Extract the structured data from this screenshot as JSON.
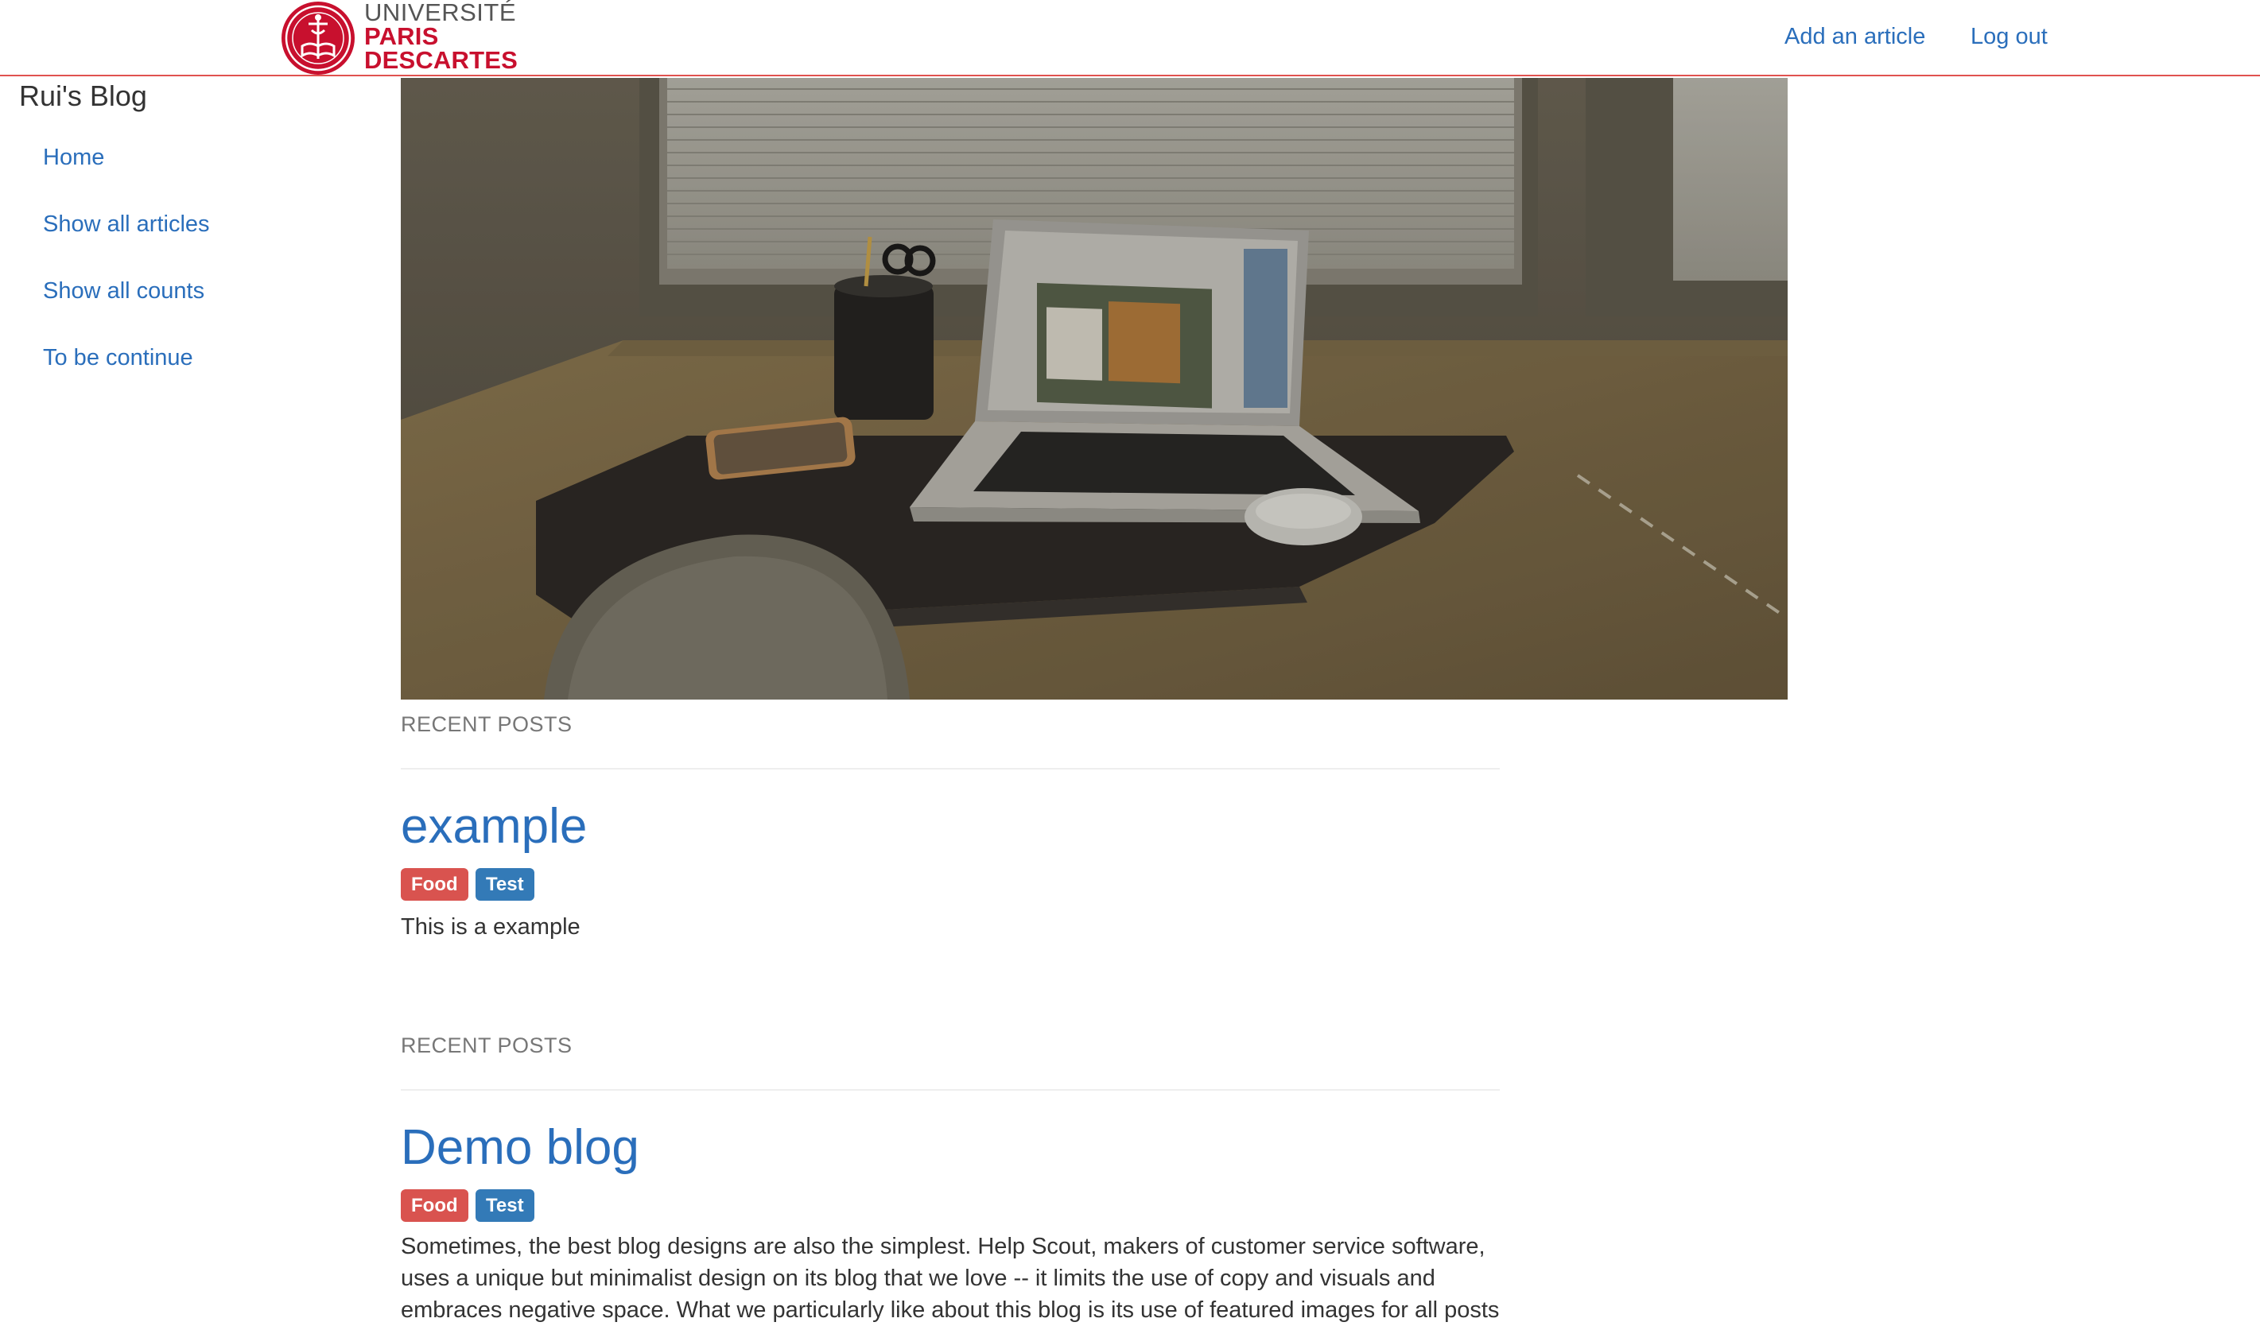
{
  "header": {
    "logo": {
      "line1": "UNIVERSITÉ",
      "line2": "PARIS",
      "line3": "DESCARTES"
    },
    "nav": {
      "add_article": "Add an article",
      "log_out": "Log out"
    }
  },
  "sidebar": {
    "title": "Rui's Blog",
    "items": [
      {
        "label": "Home"
      },
      {
        "label": "Show all articles"
      },
      {
        "label": "Show all counts"
      },
      {
        "label": "To be continue"
      }
    ]
  },
  "posts": [
    {
      "section_label": "RECENT POSTS",
      "title": "example",
      "tags": [
        "Food",
        "Test"
      ],
      "body": "This is a example"
    },
    {
      "section_label": "RECENT POSTS",
      "title": "Demo blog",
      "tags": [
        "Food",
        "Test"
      ],
      "body_lines": [
        "Sometimes, the best blog designs are also the simplest. Help Scout, makers of customer service software,",
        "uses a unique but minimalist design on its blog that we love -- it limits the use of copy and visuals and",
        "embraces negative space. What we particularly like about this blog is its use of featured images for all posts"
      ]
    }
  ],
  "colors": {
    "brand_red": "#c8102e",
    "link_blue": "#2a6ebb",
    "tag_food": "#d9534f",
    "tag_test": "#337ab7",
    "header_border": "#e0524f"
  },
  "icons": {
    "logo": "university-seal-icon",
    "hero": "desk-laptop-photo"
  }
}
